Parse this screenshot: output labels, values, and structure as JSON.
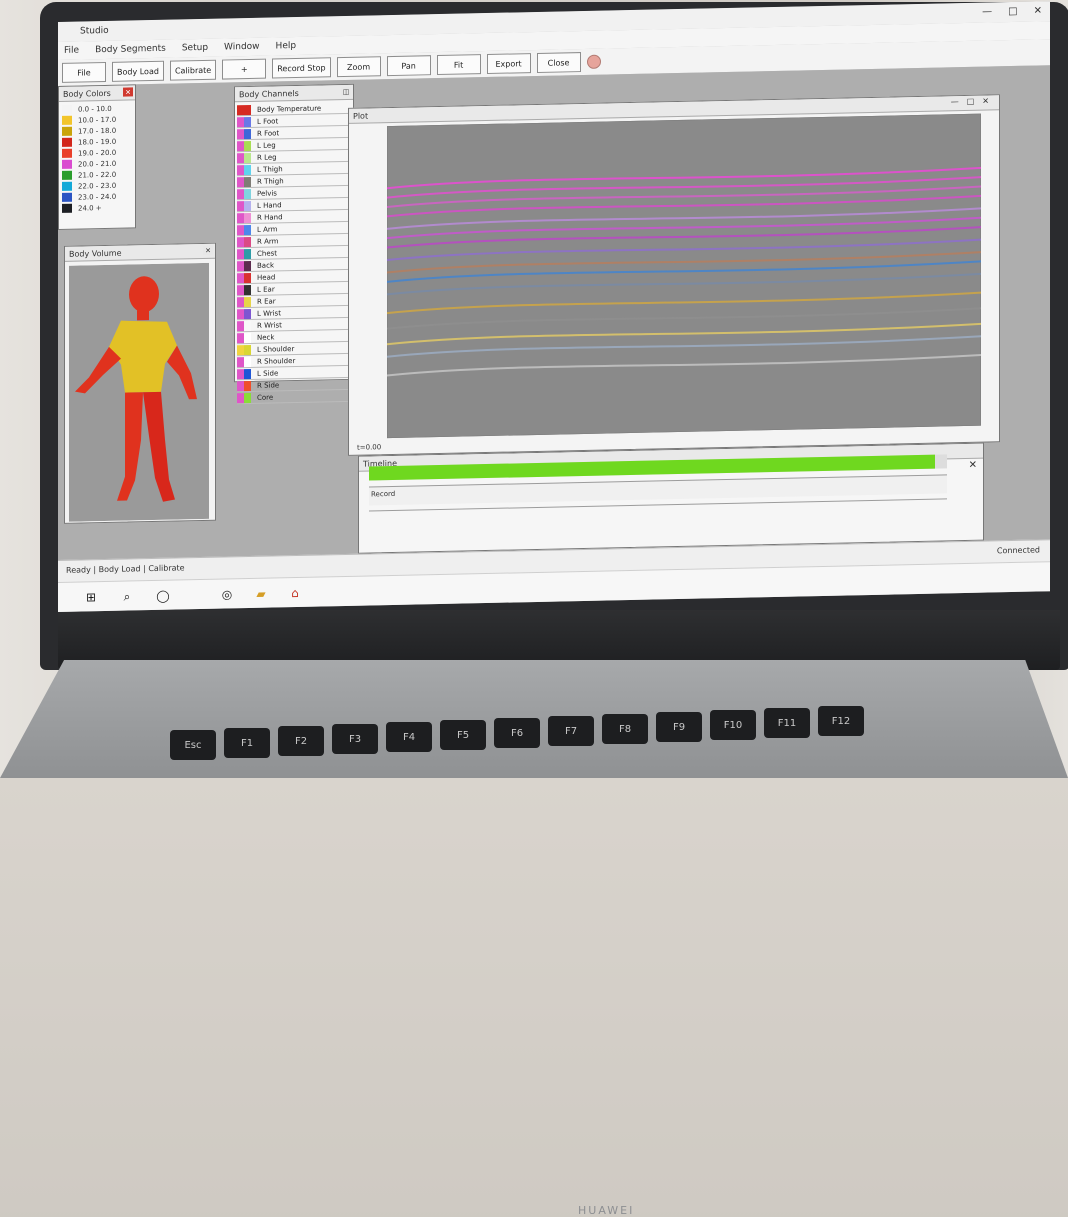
{
  "brand": "HUAWEI",
  "app": {
    "title": "Studio"
  },
  "window_buttons": [
    "—",
    "□",
    "✕"
  ],
  "menu": [
    "File",
    "Body Segments",
    "Setup",
    "Window",
    "Help"
  ],
  "toolbar": {
    "buttons": [
      "File",
      "Body Load",
      "Calibrate",
      "+",
      "Record Stop",
      "Zoom",
      "Pan",
      "Fit",
      "Export",
      "Close"
    ],
    "record_color": "#e6a49b"
  },
  "legend_panel": {
    "title": "Body Colors",
    "items": [
      {
        "label": "0.0 - 10.0",
        "color": "#f4f4f4"
      },
      {
        "label": "10.0 - 17.0",
        "color": "#f2c52b"
      },
      {
        "label": "17.0 - 18.0",
        "color": "#c9a40a"
      },
      {
        "label": "18.0 - 19.0",
        "color": "#d2261b"
      },
      {
        "label": "19.0 - 20.0",
        "color": "#e93f2a"
      },
      {
        "label": "20.0 - 21.0",
        "color": "#da4bd0"
      },
      {
        "label": "21.0 - 22.0",
        "color": "#2a9d2c"
      },
      {
        "label": "22.0 - 23.0",
        "color": "#14a9d8"
      },
      {
        "label": "23.0 - 24.0",
        "color": "#2a54c3"
      },
      {
        "label": "24.0 +",
        "color": "#1d1f24"
      }
    ]
  },
  "body_panel": {
    "title": "Body Volume"
  },
  "segments_panel": {
    "title": "Body Channels",
    "rows": [
      {
        "c1": "#d62a22",
        "c2": "#d62a22",
        "label": "Body Temperature"
      },
      {
        "c1": "#df56c8",
        "c2": "#6978e7",
        "label": "L Foot"
      },
      {
        "c1": "#df56c8",
        "c2": "#3f67d8",
        "label": "R Foot"
      },
      {
        "c1": "#df56c8",
        "c2": "#a8dd53",
        "label": "L Leg"
      },
      {
        "c1": "#df56c8",
        "c2": "#b9e68e",
        "label": "R Leg"
      },
      {
        "c1": "#df56c8",
        "c2": "#5fd2ee",
        "label": "L Thigh"
      },
      {
        "c1": "#df56c8",
        "c2": "#7f7c76",
        "label": "R Thigh"
      },
      {
        "c1": "#df56c8",
        "c2": "#7fd3df",
        "label": "Pelvis"
      },
      {
        "c1": "#df56c8",
        "c2": "#b5b2ee",
        "label": "L Hand"
      },
      {
        "c1": "#df56c8",
        "c2": "#ee90d3",
        "label": "R Hand"
      },
      {
        "c1": "#df56c8",
        "c2": "#4d87ea",
        "label": "L Arm"
      },
      {
        "c1": "#df56c8",
        "c2": "#db4a85",
        "label": "R Arm"
      },
      {
        "c1": "#df56c8",
        "c2": "#2e9ca7",
        "label": "Chest"
      },
      {
        "c1": "#df56c8",
        "c2": "#5d2c4e",
        "label": "Back"
      },
      {
        "c1": "#df56c8",
        "c2": "#d93131",
        "label": "Head"
      },
      {
        "c1": "#df56c8",
        "c2": "#313131",
        "label": "L Ear"
      },
      {
        "c1": "#df56c8",
        "c2": "#e7d44a",
        "label": "R Ear"
      },
      {
        "c1": "#df56c8",
        "c2": "#7d56d1",
        "label": "L Wrist"
      },
      {
        "c1": "#df56c8",
        "c2": "#f8f8f8",
        "label": "R Wrist"
      },
      {
        "c1": "#df56c8",
        "c2": "#ffffff",
        "label": "Neck"
      },
      {
        "c1": "#f1d43f",
        "c2": "#d9d633",
        "label": "L Shoulder"
      },
      {
        "c1": "#df56c8",
        "c2": "#ffffff",
        "label": "R Shoulder"
      },
      {
        "c1": "#df56c8",
        "c2": "#1f56d6",
        "label": "L Side"
      },
      {
        "c1": "#df56c8",
        "c2": "#f04e2a",
        "label": "R Side"
      },
      {
        "c1": "#df56c8",
        "c2": "#89dc38",
        "label": "Core"
      }
    ]
  },
  "plot_window": {
    "title": "Plot",
    "status": "t=0.00",
    "bg": "#8a8a8a",
    "lines": [
      {
        "level": 0.82,
        "color": "#e050d0"
      },
      {
        "level": 0.79,
        "color": "#d955c9"
      },
      {
        "level": 0.76,
        "color": "#cc63c3"
      },
      {
        "level": 0.73,
        "color": "#d052c5"
      },
      {
        "level": 0.69,
        "color": "#b48bd2"
      },
      {
        "level": 0.66,
        "color": "#c35acb"
      },
      {
        "level": 0.63,
        "color": "#b64ec1"
      },
      {
        "level": 0.59,
        "color": "#8d72c6"
      },
      {
        "level": 0.55,
        "color": "#b17f63"
      },
      {
        "level": 0.52,
        "color": "#4b85c8"
      },
      {
        "level": 0.48,
        "color": "#7a8aa3"
      },
      {
        "level": 0.42,
        "color": "#c8a34a"
      },
      {
        "level": 0.37,
        "color": "#8e8e8e"
      },
      {
        "level": 0.32,
        "color": "#d7c26a"
      },
      {
        "level": 0.28,
        "color": "#9aa9bd"
      },
      {
        "level": 0.22,
        "color": "#bfbfbf"
      }
    ]
  },
  "bottom_window": {
    "title": "Timeline",
    "left_label": "Record",
    "progress": 0.98,
    "progress_color": "#6fd81f"
  },
  "statusbar": {
    "left": "Ready | Body Load | Calibrate",
    "right": "Connected"
  },
  "taskbar": {
    "icons": [
      "start-icon",
      "search-icon",
      "chat-icon",
      "browser-icon",
      "folder-icon",
      "app-icon"
    ]
  }
}
